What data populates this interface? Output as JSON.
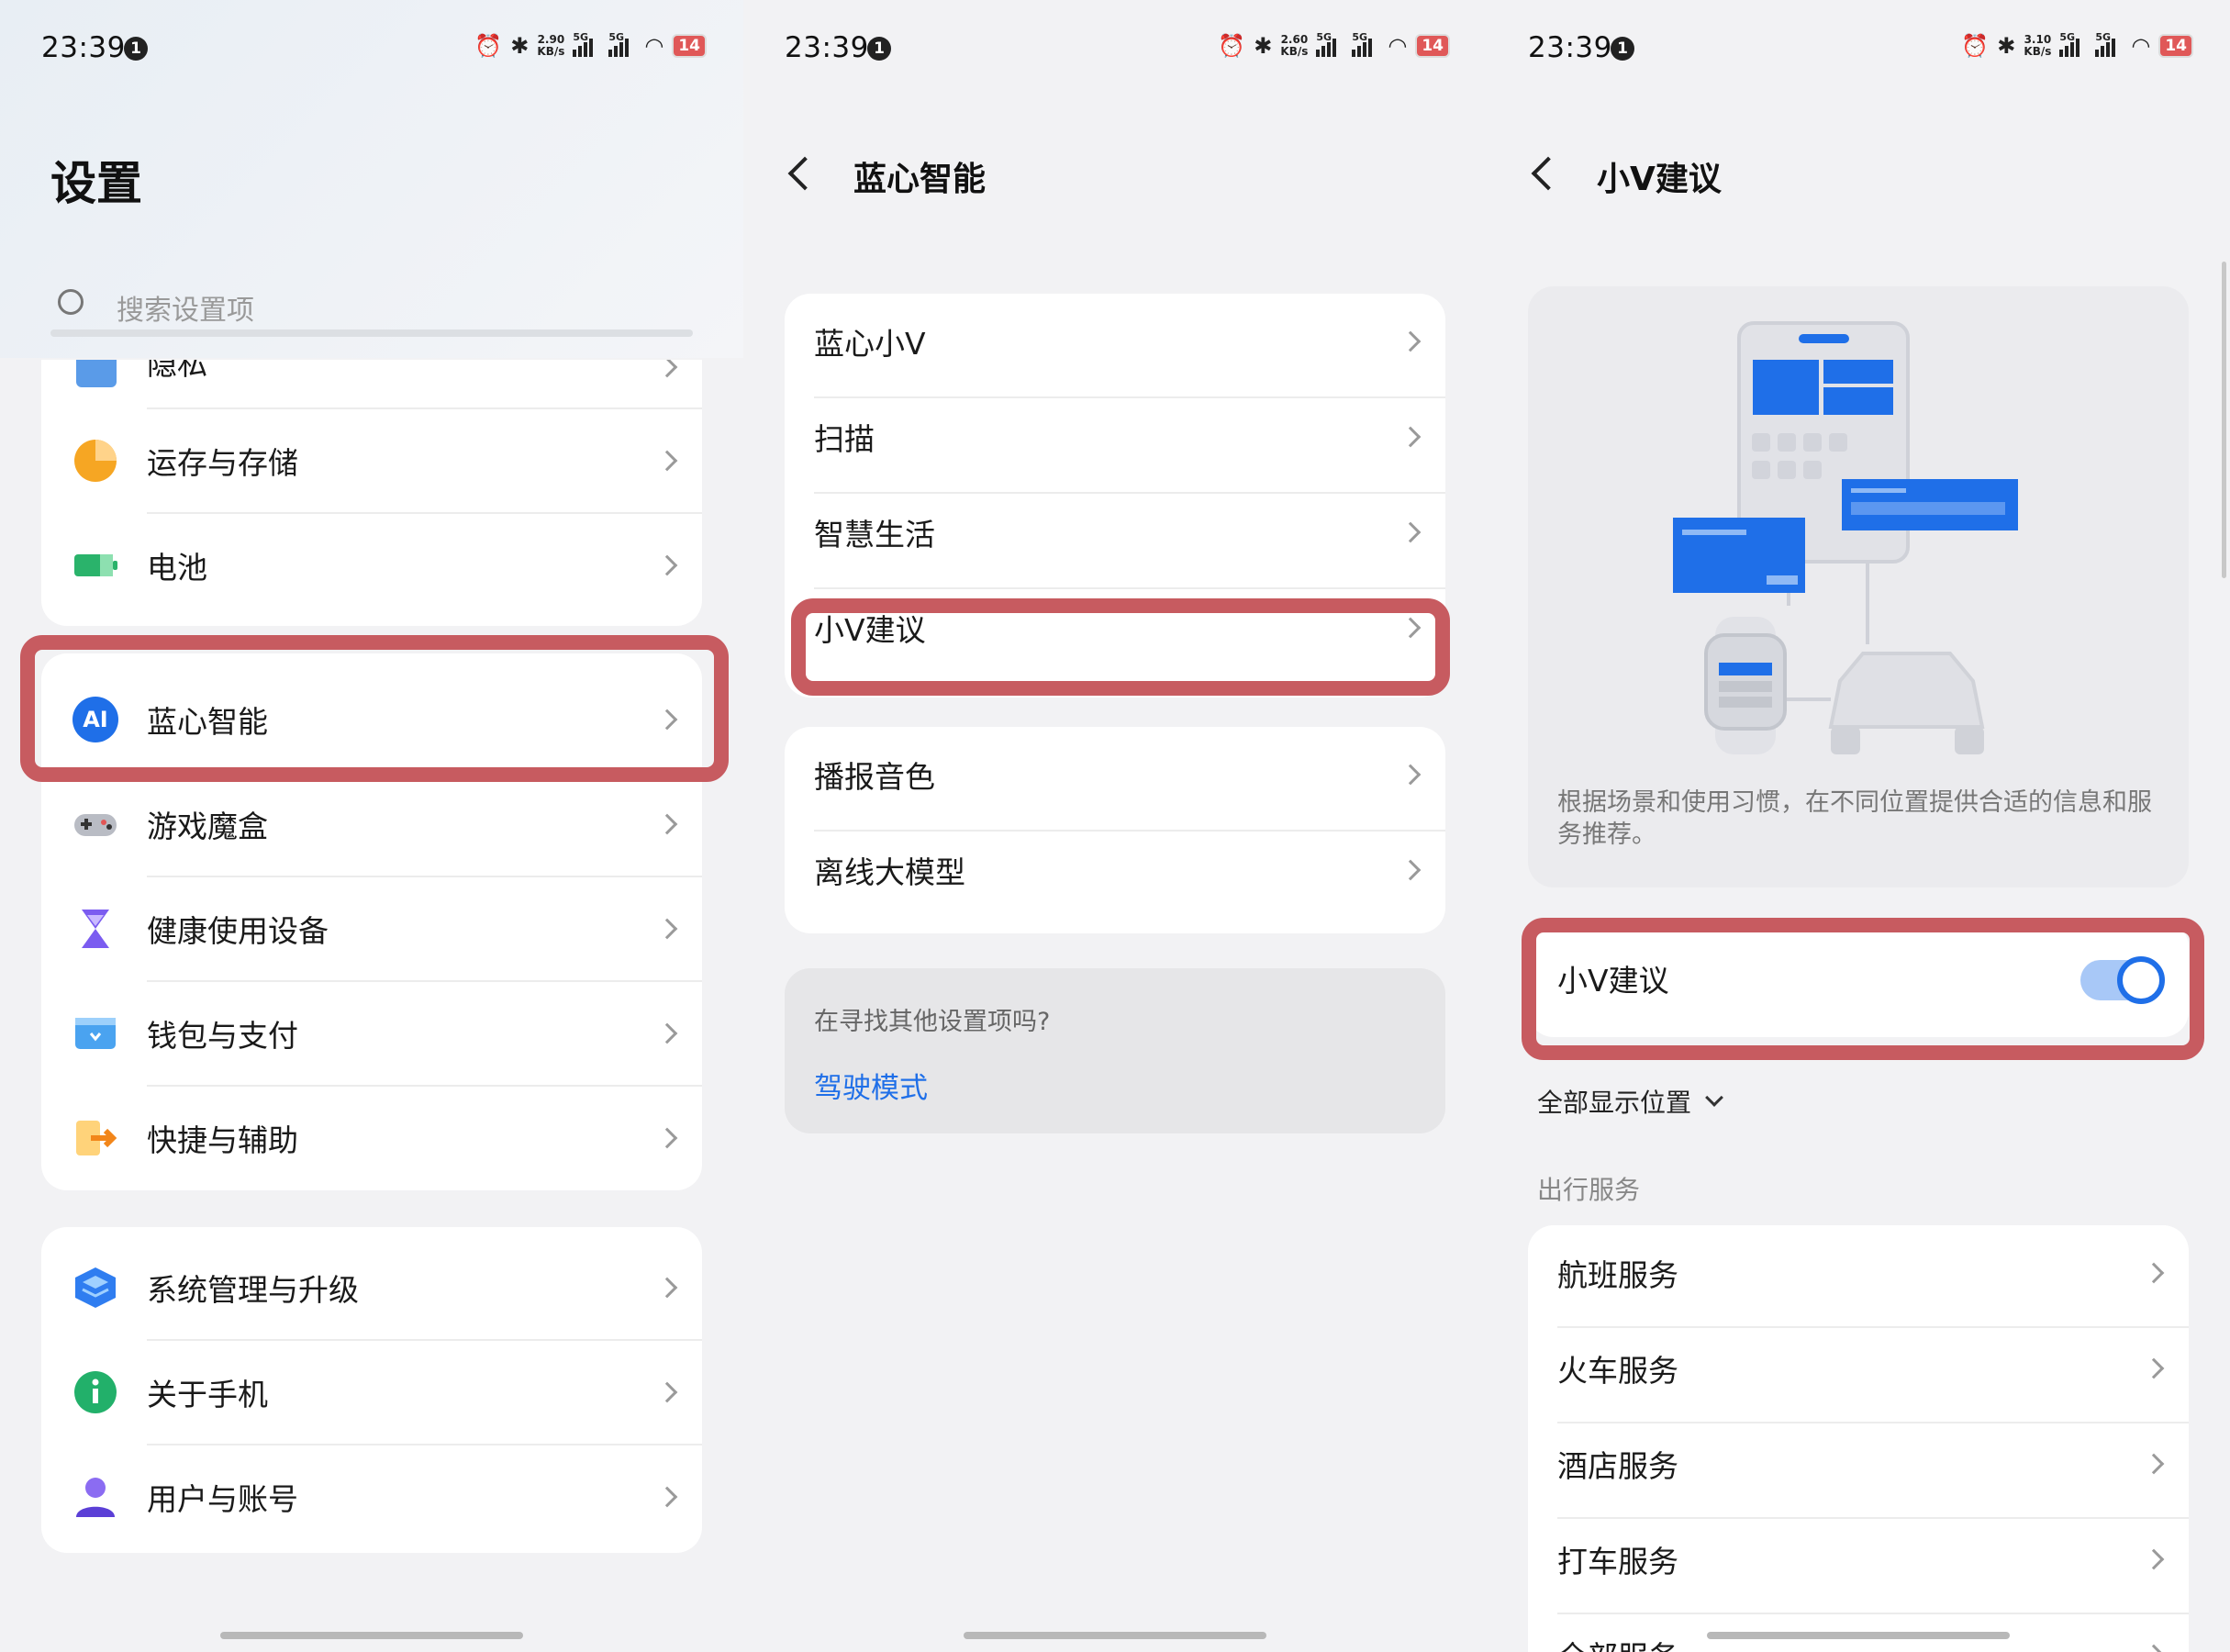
{
  "status": {
    "time": "23:39",
    "notif": "1",
    "speed1_val": "2.90",
    "speed2_val": "2.60",
    "speed3_val": "3.10",
    "speed_unit": "KB/s",
    "net": "5G",
    "battery": "14"
  },
  "settings": {
    "title": "设置",
    "search_placeholder": "搜索设置项",
    "partial_item": "隐私",
    "group1": [
      "运存与存储",
      "电池"
    ],
    "group2": [
      "蓝心智能",
      "游戏魔盒",
      "健康使用设备",
      "钱包与支付",
      "快捷与辅助"
    ],
    "group3": [
      "系统管理与升级",
      "关于手机",
      "用户与账号"
    ],
    "ai_icon_text": "AI"
  },
  "bluevivo": {
    "title": "蓝心智能",
    "group1": [
      "蓝心小V",
      "扫描",
      "智慧生活",
      "小V建议"
    ],
    "group2": [
      "播报音色",
      "离线大模型"
    ],
    "help_question": "在寻找其他设置项吗?",
    "help_link": "驾驶模式"
  },
  "suggestion": {
    "title": "小V建议",
    "description": "根据场景和使用习惯，在不同位置提供合适的信息和服务推荐。",
    "toggle_label": "小V建议",
    "toggle_on": true,
    "display_position": "全部显示位置",
    "section_title": "出行服务",
    "services": [
      "航班服务",
      "火车服务",
      "酒店服务",
      "打车服务",
      "全部服务"
    ]
  },
  "colors": {
    "accent_blue": "#1f6fe8",
    "highlight_red": "#c75b60",
    "panel_bg": "#f2f2f4"
  }
}
